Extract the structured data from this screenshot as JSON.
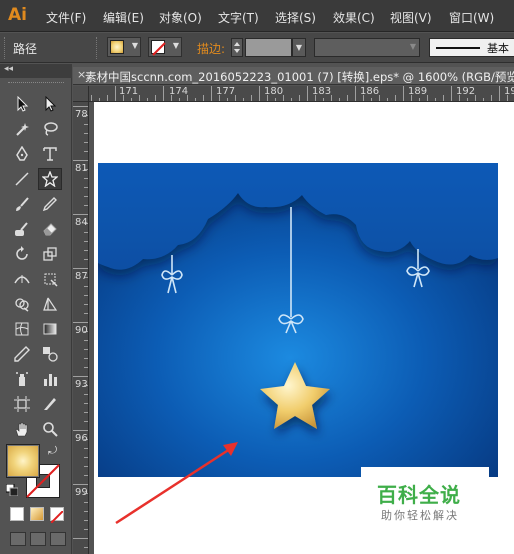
{
  "app": {
    "logo": "Ai"
  },
  "menu": [
    "文件(F)",
    "编辑(E)",
    "对象(O)",
    "文字(T)",
    "选择(S)",
    "效果(C)",
    "视图(V)",
    "窗口(W)"
  ],
  "control_bar": {
    "selection_label": "路径",
    "stroke_label": "描边:",
    "brush_label": "基本"
  },
  "tools_panel": {
    "collapse_glyph": "◂◂",
    "tools": [
      "selection-tool",
      "direct-selection-tool",
      "magic-wand-tool",
      "lasso-tool",
      "pen-tool",
      "type-tool",
      "line-tool",
      "star-tool",
      "paintbrush-tool",
      "pencil-tool",
      "blob-brush-tool",
      "eraser-tool",
      "rotate-tool",
      "scale-tool",
      "width-tool",
      "free-transform-tool",
      "shape-builder-tool",
      "perspective-grid-tool",
      "mesh-tool",
      "gradient-tool",
      "eyedropper-tool",
      "blend-tool",
      "symbol-sprayer-tool",
      "column-graph-tool",
      "artboard-tool",
      "slice-tool",
      "hand-tool",
      "zoom-tool"
    ],
    "active_tool": "star-tool",
    "swap_glyph": "⤾"
  },
  "document": {
    "close_glyph": "×",
    "tab_title": "素材中国sccnn.com_2016052223_01001  (7)  [转换].eps* @ 1600% (RGB/预览)"
  },
  "rulers": {
    "horizontal": [
      "171",
      "174",
      "177",
      "180",
      "183",
      "186",
      "189",
      "192",
      "19"
    ],
    "vertical": [
      "78",
      "81",
      "84",
      "87",
      "90",
      "93",
      "96",
      "99"
    ]
  },
  "watermark": {
    "title": "百科全说",
    "subtitle": "助你轻松解决"
  },
  "colors": {
    "accent": "#e08a1e",
    "canvas_blue_dark": "#07357a",
    "canvas_blue_light": "#1a7fd6",
    "star_gold": "#f2cf6d",
    "watermark_green": "#3fae49",
    "arrow_red": "#e8312c"
  }
}
